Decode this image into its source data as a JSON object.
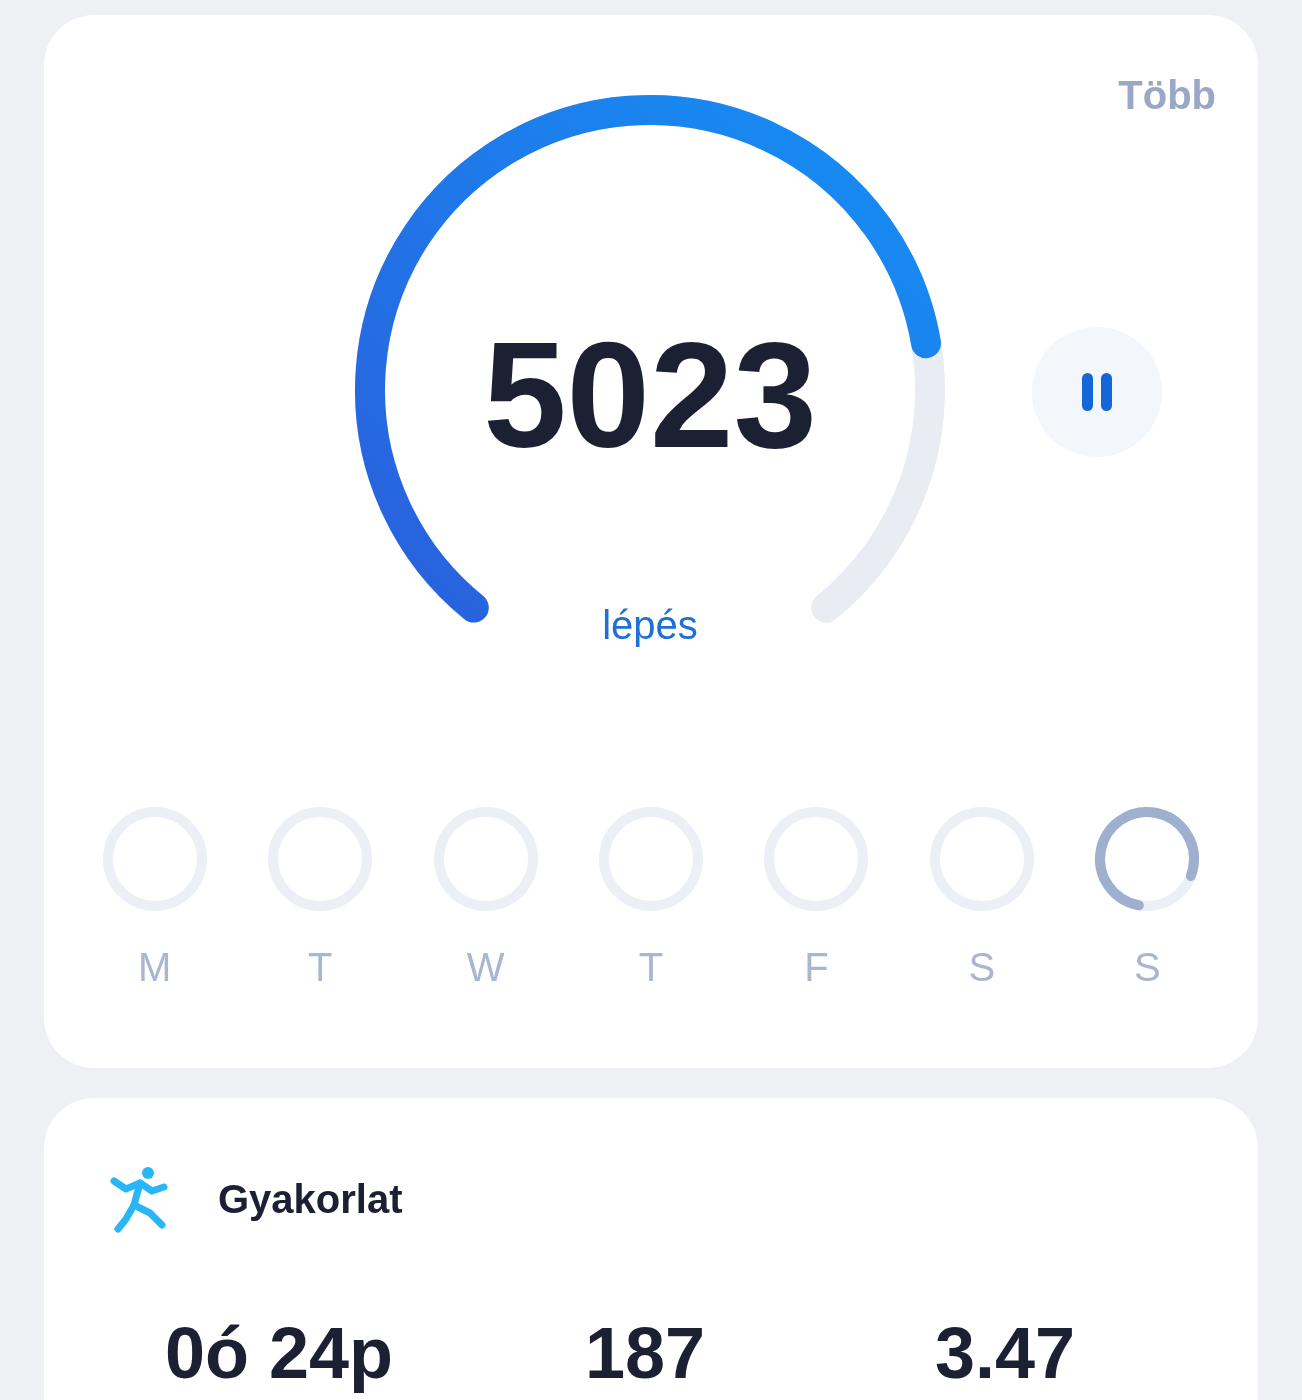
{
  "header": {
    "more_link": "Több"
  },
  "steps": {
    "count": "5023",
    "unit": "lépés"
  },
  "week": [
    {
      "label": "M"
    },
    {
      "label": "T"
    },
    {
      "label": "W"
    },
    {
      "label": "T"
    },
    {
      "label": "F"
    },
    {
      "label": "S"
    },
    {
      "label": "S"
    }
  ],
  "exercise": {
    "title": "Gyakorlat",
    "stats": [
      "0ó 24p",
      "187",
      "3.47"
    ]
  }
}
